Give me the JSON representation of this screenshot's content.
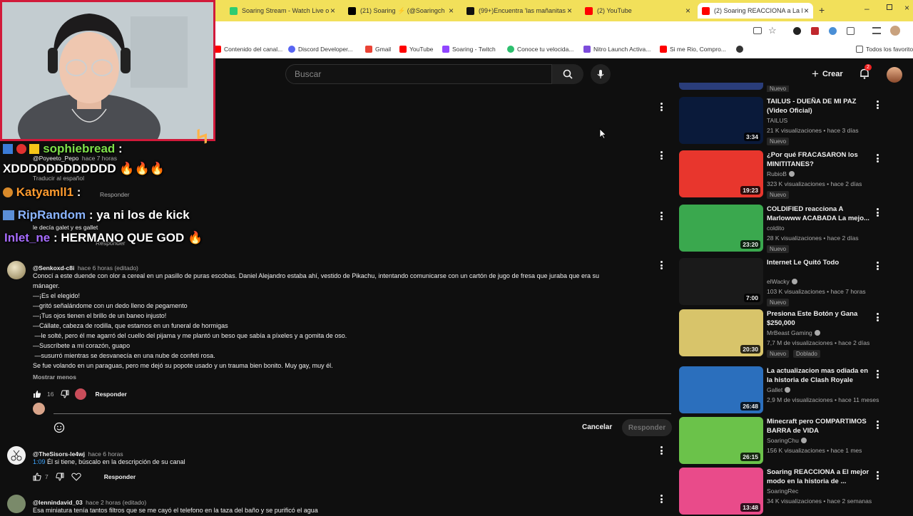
{
  "browser": {
    "tabs": [
      {
        "label": "Soaring Stream - Watch Live o",
        "color": "#2ecc71"
      },
      {
        "label": "(21) Soaring ⚡ (@Soaringch",
        "color": "#000000"
      },
      {
        "label": "(99+)Encuentra 'las mañanitas",
        "color": "#111111"
      },
      {
        "label": "(2) YouTube",
        "color": "#ff0000"
      },
      {
        "label": "(2) Soaring REACCIONA a La l",
        "color": "#ff0000"
      }
    ],
    "bookmarks": [
      "Contenido del canal...",
      "Discord Developer...",
      "Gmail",
      "YouTube",
      "Soaring - Twitch",
      "Conoce tu velocida...",
      "Nitro Launch Activa...",
      "Si me Rio, Compro...",
      "Todos los favoritos"
    ]
  },
  "masthead": {
    "search_placeholder": "Buscar",
    "create_label": "Crear",
    "notif_count": "2"
  },
  "stream_chat": [
    {
      "user": "sophiebread",
      "sep": ":",
      "message": ""
    },
    {
      "user": "",
      "sep": "",
      "message": "XDDDDDDDDDDDD 🔥🔥🔥"
    },
    {
      "user": "Katyamll1",
      "sep": ":",
      "message": ""
    },
    {
      "user": "RipRandom",
      "sep": ":",
      "message": "ya ni los de kick"
    },
    {
      "user": "Inlet_ne",
      "sep": ":",
      "message": "HERMANO QUE GOD 🔥"
    }
  ],
  "background_comments": {
    "handle1": "@Poyeeto_Pepo",
    "meta1": "hace 7 horas",
    "translate": "Traducir al español",
    "reply_label": "Responder",
    "text2": "le decía galet y es gallet"
  },
  "comment_main": {
    "handle": "@Senkoxd-c8i",
    "meta": "hace 6 horas (editado)",
    "lines": [
      "Conocí a este duende con olor a cereal en un pasillo de puras escobas. Daniel Alejandro estaba ahí, vestido de Pikachu, intentando comunicarse con un cartón de jugo de fresa que juraba que era su",
      "mánager.",
      "—¡Es el elegido!",
      "—gritó señalándome con un dedo lleno de pegamento",
      "—¡Tus ojos tienen el brillo de un baneo injusto!",
      "—Cállate, cabeza de rodilla, que estamos en un funeral de hormigas",
      " —le solté, pero él me agarró del cuello del pijama y me plantó un beso que sabía a píxeles y a gomita de oso.",
      "—Suscríbete a mi corazón, guapo",
      " —susurró mientras se desvanecía en una nube de confeti rosa.",
      "Se fue volando en un paraguas, pero me dejó su popote usado y un trauma bien bonito. Muy gay, muy él."
    ],
    "show_less": "Mostrar menos",
    "likes": "16",
    "reply_label": "Responder"
  },
  "reply_box": {
    "cancel_label": "Cancelar",
    "reply_label": "Responder"
  },
  "comment_2": {
    "handle": "@TheSisors-le4wj",
    "meta": "hace 6 horas",
    "timestamp": "1:09",
    "text": "Él si tiene, búscalo en la descripción de su canal",
    "likes": "7",
    "reply_label": "Responder"
  },
  "comment_3": {
    "handle": "@lennindavid_03",
    "meta": "hace 2 horas (editado)",
    "text": "Esa miniatura tenía tantos filtros que se me cayó el telefono en la taza del baño y se purificó el agua"
  },
  "sidebar": {
    "top_badge": "Nuevo",
    "items": [
      {
        "title": "TAILUS - DUEÑA DE MI PAZ (Video Oficial)",
        "channel": "TAILUS",
        "verified": false,
        "stats": "21 K visualizaciones • hace 3 días",
        "badge": "Nuevo",
        "duration": "3:34",
        "thumb": "#0a1a3a"
      },
      {
        "title": "¿Por qué FRACASARON los MINITITANES?",
        "channel": "RubioB",
        "verified": true,
        "stats": "323 K visualizaciones • hace 2 días",
        "badge": "Nuevo",
        "duration": "19:23",
        "thumb": "#e8362d"
      },
      {
        "title": "COLDIFIED reacciona A Marlowww ACABADA La mejo...",
        "channel": "coldito",
        "verified": false,
        "stats": "28 K visualizaciones • hace 2 días",
        "badge": "Nuevo",
        "duration": "23:20",
        "thumb": "#3aa84e"
      },
      {
        "title": "Internet Le Quitó Todo",
        "channel": "elWacky",
        "verified": true,
        "stats": "103 K visualizaciones • hace 7 horas",
        "badge": "Nuevo",
        "duration": "7:00",
        "thumb": "#1a1a1a"
      },
      {
        "title": "Presiona Este Botón y Gana $250,000",
        "channel": "MrBeast Gaming",
        "verified": true,
        "stats": "7,7 M de visualizaciones • hace 2 días",
        "badge": "Nuevo",
        "badge2": "Doblado",
        "duration": "20:30",
        "thumb": "#d8c46a"
      },
      {
        "title": "La actualizacion mas odiada en la historia de Clash Royale",
        "channel": "Gallet",
        "verified": true,
        "stats": "2,9 M de visualizaciones • hace 11 meses",
        "duration": "26:48",
        "thumb": "#2b6fbd"
      },
      {
        "title": "Minecraft pero COMPARTIMOS BARRA de VIDA",
        "channel": "SoaringChu",
        "verified": true,
        "stats": "156 K visualizaciones • hace 1 mes",
        "duration": "26:15",
        "thumb": "#6bc24a"
      },
      {
        "title": "Soaring REACCIONA a El mejor modo en la historia de ...",
        "channel": "SoaringRec",
        "verified": false,
        "stats": "34 K visualizaciones • hace 2 semanas",
        "duration": "13:48",
        "thumb": "#e94b8a"
      }
    ]
  }
}
